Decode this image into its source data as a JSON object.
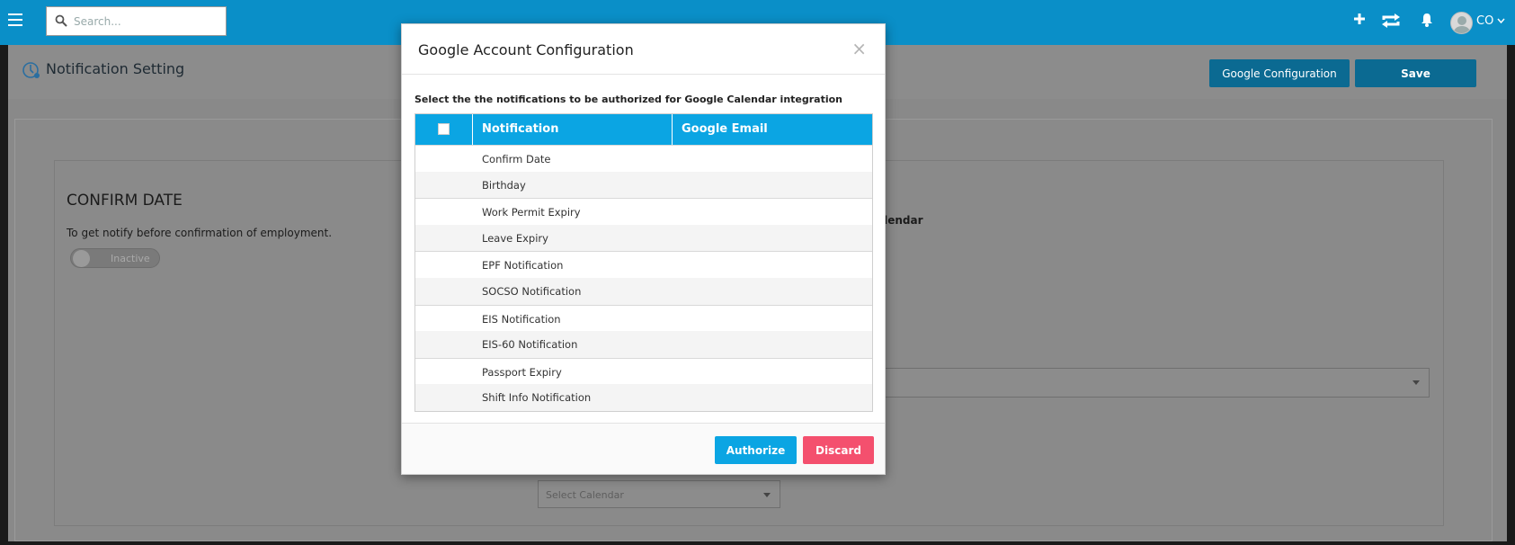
{
  "topbar": {
    "search_placeholder": "Search...",
    "user_label": "CO"
  },
  "header": {
    "title": "Notification Setting",
    "google_config_label": "Google Configuration",
    "save_label": "Save"
  },
  "background": {
    "confirm_title": "CONFIRM DATE",
    "confirm_desc": "To get notify before confirmation of employment.",
    "toggle_label": "Inactive",
    "calendar_fragment": "alendar",
    "select_calendar": "Select Calendar"
  },
  "modal": {
    "title": "Google Account Configuration",
    "close_symbol": "×",
    "description": "Select the the notifications to be authorized for Google Calendar integration",
    "columns": {
      "notification": "Notification",
      "google_email": "Google Email"
    },
    "rows": [
      {
        "notification": "Confirm Date",
        "email": ""
      },
      {
        "notification": "Birthday",
        "email": ""
      },
      {
        "notification": "Work Permit Expiry",
        "email": ""
      },
      {
        "notification": "Leave Expiry",
        "email": ""
      },
      {
        "notification": "EPF Notification",
        "email": ""
      },
      {
        "notification": "SOCSO Notification",
        "email": ""
      },
      {
        "notification": "EIS Notification",
        "email": ""
      },
      {
        "notification": "EIS-60 Notification",
        "email": ""
      },
      {
        "notification": "Passport Expiry",
        "email": ""
      },
      {
        "notification": "Shift Info Notification",
        "email": ""
      }
    ],
    "authorize_label": "Authorize",
    "discard_label": "Discard"
  },
  "colors": {
    "topbar": "#0a8fc8",
    "table_header": "#0ba5e3",
    "authorize": "#0ba5e3",
    "discard": "#f4506e"
  }
}
